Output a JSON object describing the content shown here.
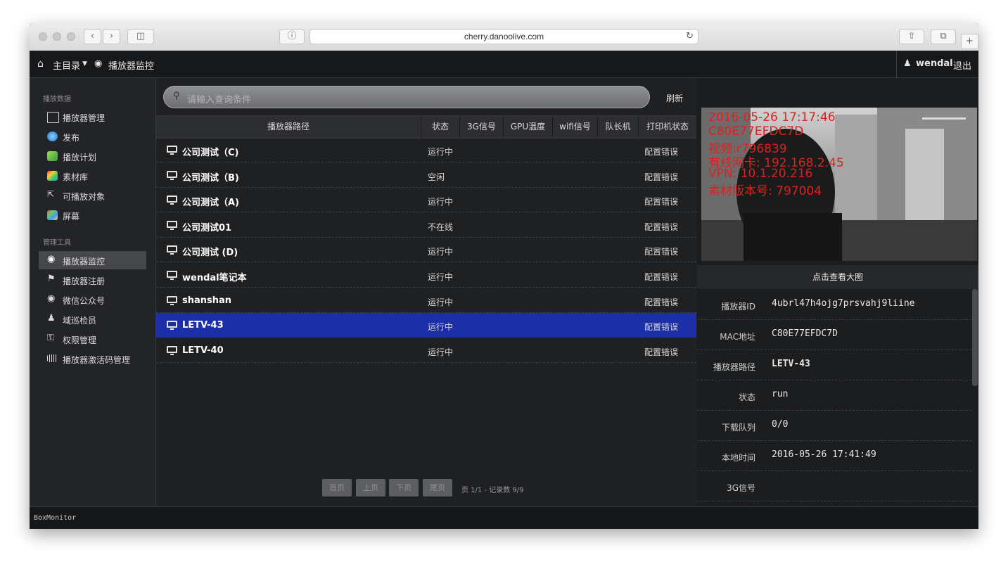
{
  "browser": {
    "url": "cherry.danoolive.com"
  },
  "header": {
    "home_menu": "主目录",
    "page_title": "播放器监控",
    "user": "wendal",
    "logout": "退出"
  },
  "sidebar": {
    "section1": "播放数据",
    "items1": [
      {
        "label": "播放器管理",
        "icon": "monitor-icon"
      },
      {
        "label": "发布",
        "icon": "globe-icon"
      },
      {
        "label": "播放计划",
        "icon": "calendar-icon"
      },
      {
        "label": "素材库",
        "icon": "palette-icon"
      },
      {
        "label": "可播放对象",
        "icon": "cursor-icon"
      },
      {
        "label": "屏幕",
        "icon": "screen-icon"
      }
    ],
    "section2": "管理工具",
    "items2": [
      {
        "label": "播放器监控",
        "icon": "dashboard-icon",
        "active": true
      },
      {
        "label": "播放器注册",
        "icon": "tags-icon"
      },
      {
        "label": "微信公众号",
        "icon": "wechat-icon"
      },
      {
        "label": "域巡检员",
        "icon": "person-icon"
      },
      {
        "label": "权限管理",
        "icon": "key-icon"
      },
      {
        "label": "播放器激活码管理",
        "icon": "barcode-icon"
      }
    ]
  },
  "search": {
    "placeholder": "请输入查询条件",
    "refresh": "刷新"
  },
  "table": {
    "columns": [
      "播放器路径",
      "状态",
      "3G信号",
      "GPU温度",
      "wifi信号",
      "队长机",
      "打印机状态"
    ],
    "rows": [
      {
        "name": "公司测试（C)",
        "status": "运行中",
        "printer": "配置错误"
      },
      {
        "name": "公司测试（B)",
        "status": "空闲",
        "printer": "配置错误"
      },
      {
        "name": "公司测试（A)",
        "status": "运行中",
        "printer": "配置错误"
      },
      {
        "name": "公司测试01",
        "status": "不在线",
        "printer": "配置错误"
      },
      {
        "name": "公司测试 (D)",
        "status": "运行中",
        "printer": "配置错误"
      },
      {
        "name": "wendal笔记本",
        "status": "运行中",
        "printer": "配置错误"
      },
      {
        "name": "shanshan",
        "status": "运行中",
        "printer": "配置错误"
      },
      {
        "name": "LETV-43",
        "status": "运行中",
        "printer": "配置错误"
      },
      {
        "name": "LETV-40",
        "status": "运行中",
        "printer": "配置错误"
      }
    ],
    "selected_index": 7
  },
  "pager": {
    "first": "首页",
    "prev": "上页",
    "next": "下页",
    "last": "尾页",
    "info": "页 1/1 - 记录数 9/9"
  },
  "preview": {
    "overlay": [
      "2016-05-26 17:17:46",
      "C80E77EFDC7D",
      "视频:r796839",
      "有线网卡: 192.168.2.45",
      "VPN: 10.1.20.216",
      "素材版本号: 797004"
    ],
    "caption": "点击查看大图"
  },
  "details": [
    {
      "key": "播放器ID",
      "value": "4ubrl47h4ojg7prsvahj9liine"
    },
    {
      "key": "MAC地址",
      "value": "C80E77EFDC7D"
    },
    {
      "key": "播放器路径",
      "value": "LETV-43"
    },
    {
      "key": "状态",
      "value": "run"
    },
    {
      "key": "下载队列",
      "value": "0/0"
    },
    {
      "key": "本地时间",
      "value": "2016-05-26 17:41:49"
    },
    {
      "key": "3G信号",
      "value": ""
    }
  ],
  "status_bar": "BoxMonitor"
}
